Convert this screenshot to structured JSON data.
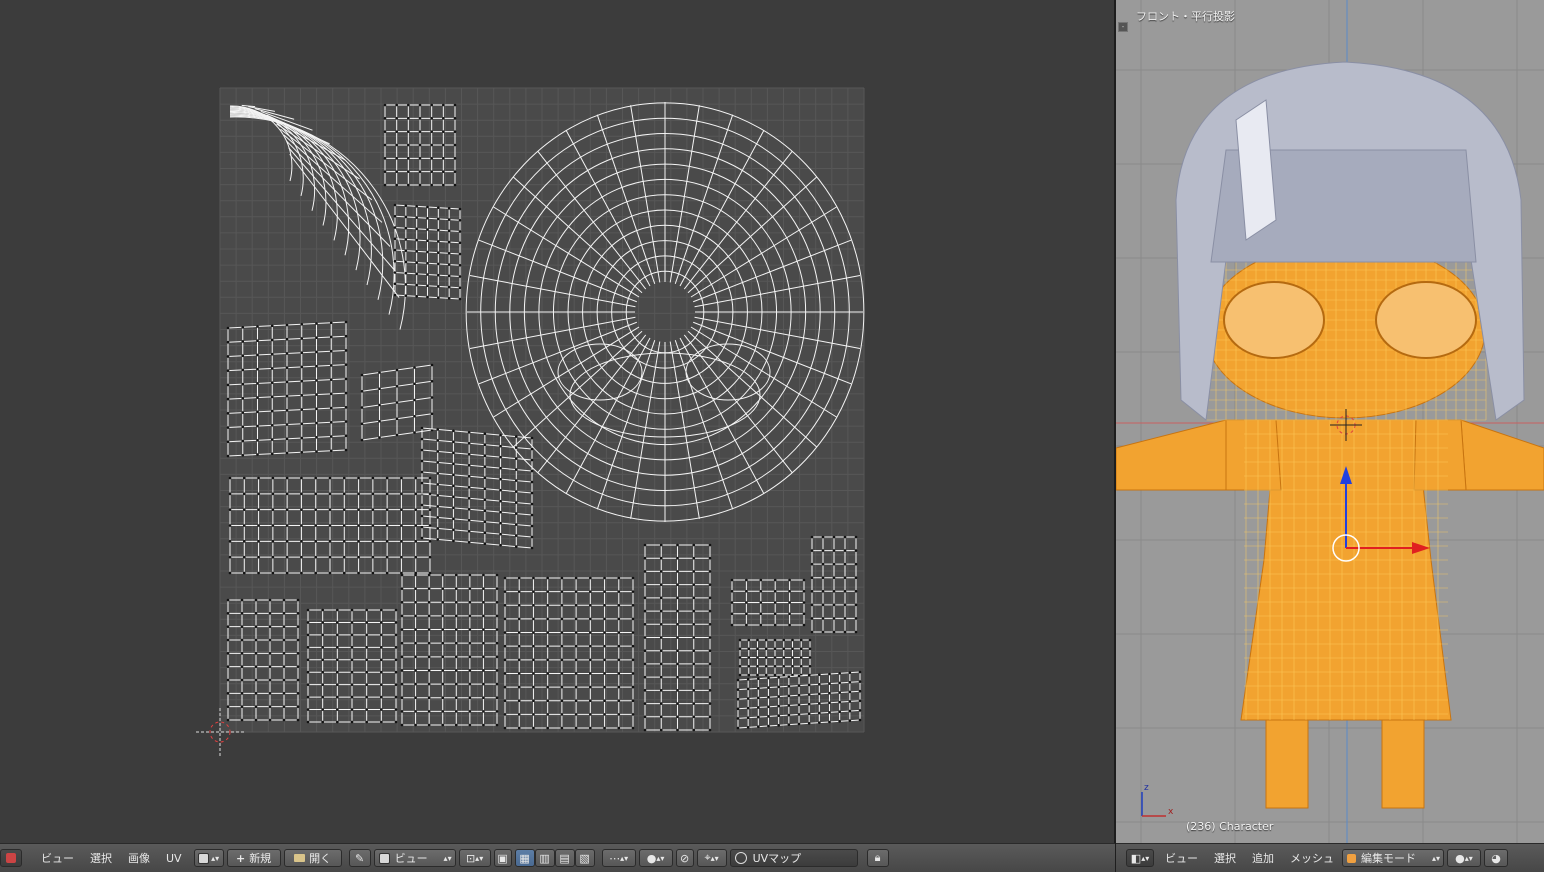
{
  "uv_editor": {
    "menu": {
      "view": "ビュー",
      "select": "選択",
      "image": "画像",
      "uv": "UV"
    },
    "new_label": "新規",
    "open_label": "開く",
    "view_dropdown": "ビュー",
    "uvmap_field": "UVマップ"
  },
  "viewport": {
    "title": "フロント・平行投影",
    "status": "(236) Character",
    "axis_z": "z",
    "axis_x": "x",
    "menu": {
      "view": "ビュー",
      "select": "選択",
      "add": "追加",
      "mesh": "メッシュ"
    },
    "mode": "編集モード"
  },
  "colors": {
    "uv_grid_bg": "#4a4a4a",
    "uv_line": "#f4f4f4",
    "mesh_orange": "#f2a330",
    "hair": "#b8bccb",
    "axis_red": "#e02020",
    "axis_blue": "#2040e0"
  },
  "icons": [
    "editor-type-icon",
    "new-image-icon",
    "open-folder-icon",
    "pin-icon",
    "image-browse-icon",
    "sticky-select-icon",
    "uv-sync-icon",
    "pivot-icon",
    "snap-icon",
    "uvmap-icon",
    "lock-icon",
    "shading-icon",
    "proportional-icon"
  ]
}
